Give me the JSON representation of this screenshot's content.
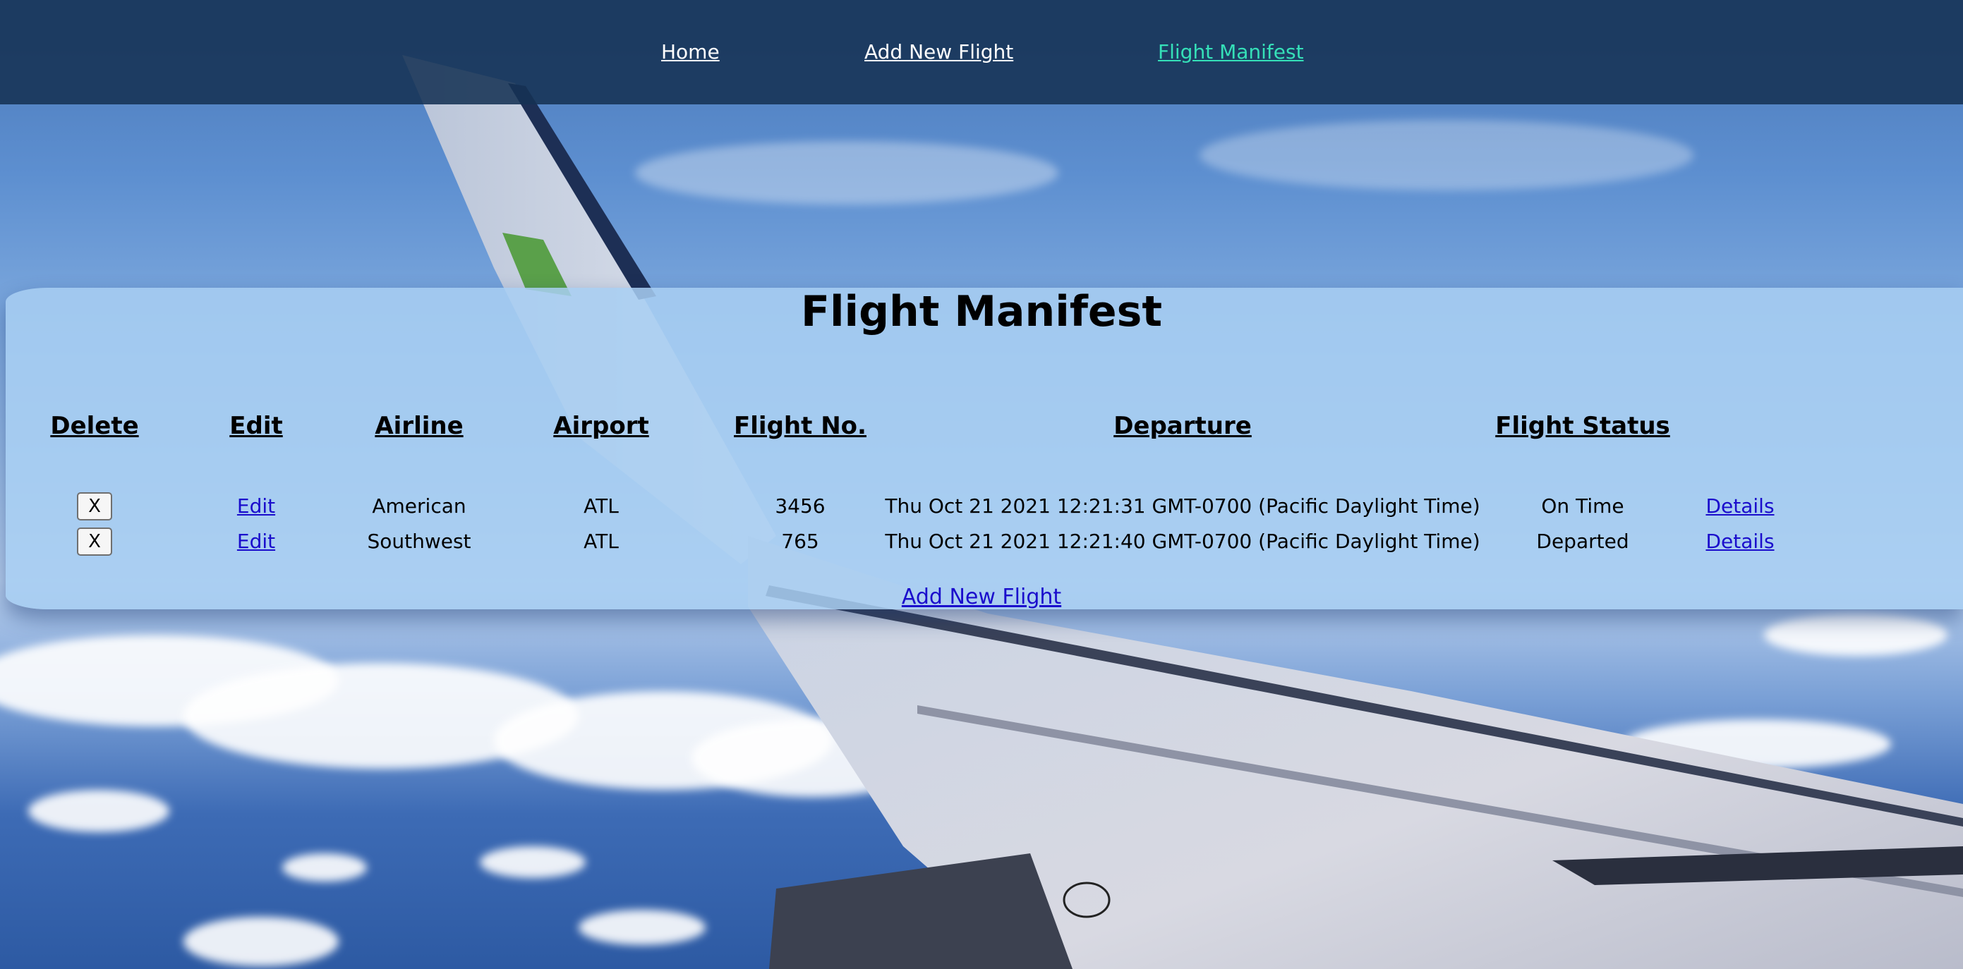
{
  "nav": {
    "items": [
      {
        "label": "Home"
      },
      {
        "label": "Add New Flight"
      },
      {
        "label": "Flight Manifest"
      }
    ]
  },
  "manifest": {
    "title": "Flight Manifest",
    "headers": {
      "delete": "Delete",
      "edit": "Edit",
      "airline": "Airline",
      "airport": "Airport",
      "flight_no": "Flight No.",
      "departure": "Departure",
      "status": "Flight Status"
    },
    "rows": [
      {
        "delete_label": "X",
        "edit_label": "Edit",
        "airline": "American",
        "airport": "ATL",
        "flight_no": "3456",
        "departure": "Thu Oct 21 2021 12:21:31 GMT-0700 (Pacific Daylight Time)",
        "status": "On Time",
        "details_label": "Details"
      },
      {
        "delete_label": "X",
        "edit_label": "Edit",
        "airline": "Southwest",
        "airport": "ATL",
        "flight_no": "765",
        "departure": "Thu Oct 21 2021 12:21:40 GMT-0700 (Pacific Daylight Time)",
        "status": "Departed",
        "details_label": "Details"
      }
    ],
    "add_link": "Add New Flight"
  },
  "colors": {
    "nav_active": "#35e0b8",
    "link": "#1a0dcc",
    "panel": "#a8cef2"
  }
}
